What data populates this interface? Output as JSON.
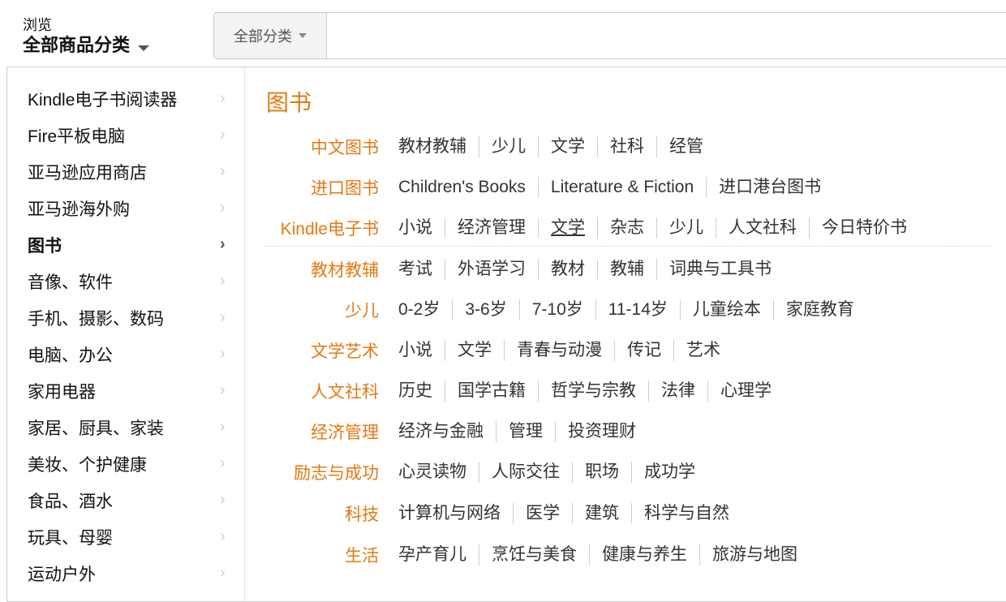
{
  "header": {
    "browse_small": "浏览",
    "browse_big": "全部商品分类",
    "search_scope": "全部分类",
    "search_placeholder": ""
  },
  "sidebar": {
    "items": [
      {
        "label": "Kindle电子书阅读器",
        "active": false
      },
      {
        "label": "Fire平板电脑",
        "active": false
      },
      {
        "label": "亚马逊应用商店",
        "active": false
      },
      {
        "label": "亚马逊海外购",
        "active": false
      },
      {
        "label": "图书",
        "active": true
      },
      {
        "label": "音像、软件",
        "active": false
      },
      {
        "label": "手机、摄影、数码",
        "active": false
      },
      {
        "label": "电脑、办公",
        "active": false
      },
      {
        "label": "家用电器",
        "active": false
      },
      {
        "label": "家居、厨具、家装",
        "active": false
      },
      {
        "label": "美妆、个护健康",
        "active": false
      },
      {
        "label": "食品、酒水",
        "active": false
      },
      {
        "label": "玩具、母婴",
        "active": false
      },
      {
        "label": "运动户外",
        "active": false
      }
    ]
  },
  "panel": {
    "title": "图书",
    "rows": [
      {
        "label": "中文图书",
        "links": [
          "教材教辅",
          "少儿",
          "文学",
          "社科",
          "经管"
        ]
      },
      {
        "label": "进口图书",
        "links": [
          "Children's Books",
          "Literature & Fiction",
          "进口港台图书"
        ]
      },
      {
        "label": "Kindle电子书",
        "links": [
          "小说",
          "经济管理",
          "文学",
          "杂志",
          "少儿",
          "人文社科",
          "今日特价书"
        ]
      },
      {
        "label": "教材教辅",
        "links": [
          "考试",
          "外语学习",
          "教材",
          "教辅",
          "词典与工具书"
        ]
      },
      {
        "label": "少儿",
        "links": [
          "0-2岁",
          "3-6岁",
          "7-10岁",
          "11-14岁",
          "儿童绘本",
          "家庭教育"
        ]
      },
      {
        "label": "文学艺术",
        "links": [
          "小说",
          "文学",
          "青春与动漫",
          "传记",
          "艺术"
        ]
      },
      {
        "label": "人文社科",
        "links": [
          "历史",
          "国学古籍",
          "哲学与宗教",
          "法律",
          "心理学"
        ]
      },
      {
        "label": "经济管理",
        "links": [
          "经济与金融",
          "管理",
          "投资理财"
        ]
      },
      {
        "label": "励志与成功",
        "links": [
          "心灵读物",
          "人际交往",
          "职场",
          "成功学"
        ]
      },
      {
        "label": "科技",
        "links": [
          "计算机与网络",
          "医学",
          "建筑",
          "科学与自然"
        ]
      },
      {
        "label": "生活",
        "links": [
          "孕产育儿",
          "烹饪与美食",
          "健康与养生",
          "旅游与地图"
        ]
      }
    ]
  },
  "colors": {
    "accent": "#e47911",
    "text": "#333333",
    "divider": "#cfcfcf"
  },
  "icons": {
    "nav_chevron": "chevron-right-icon",
    "dropdown": "caret-down-icon"
  }
}
